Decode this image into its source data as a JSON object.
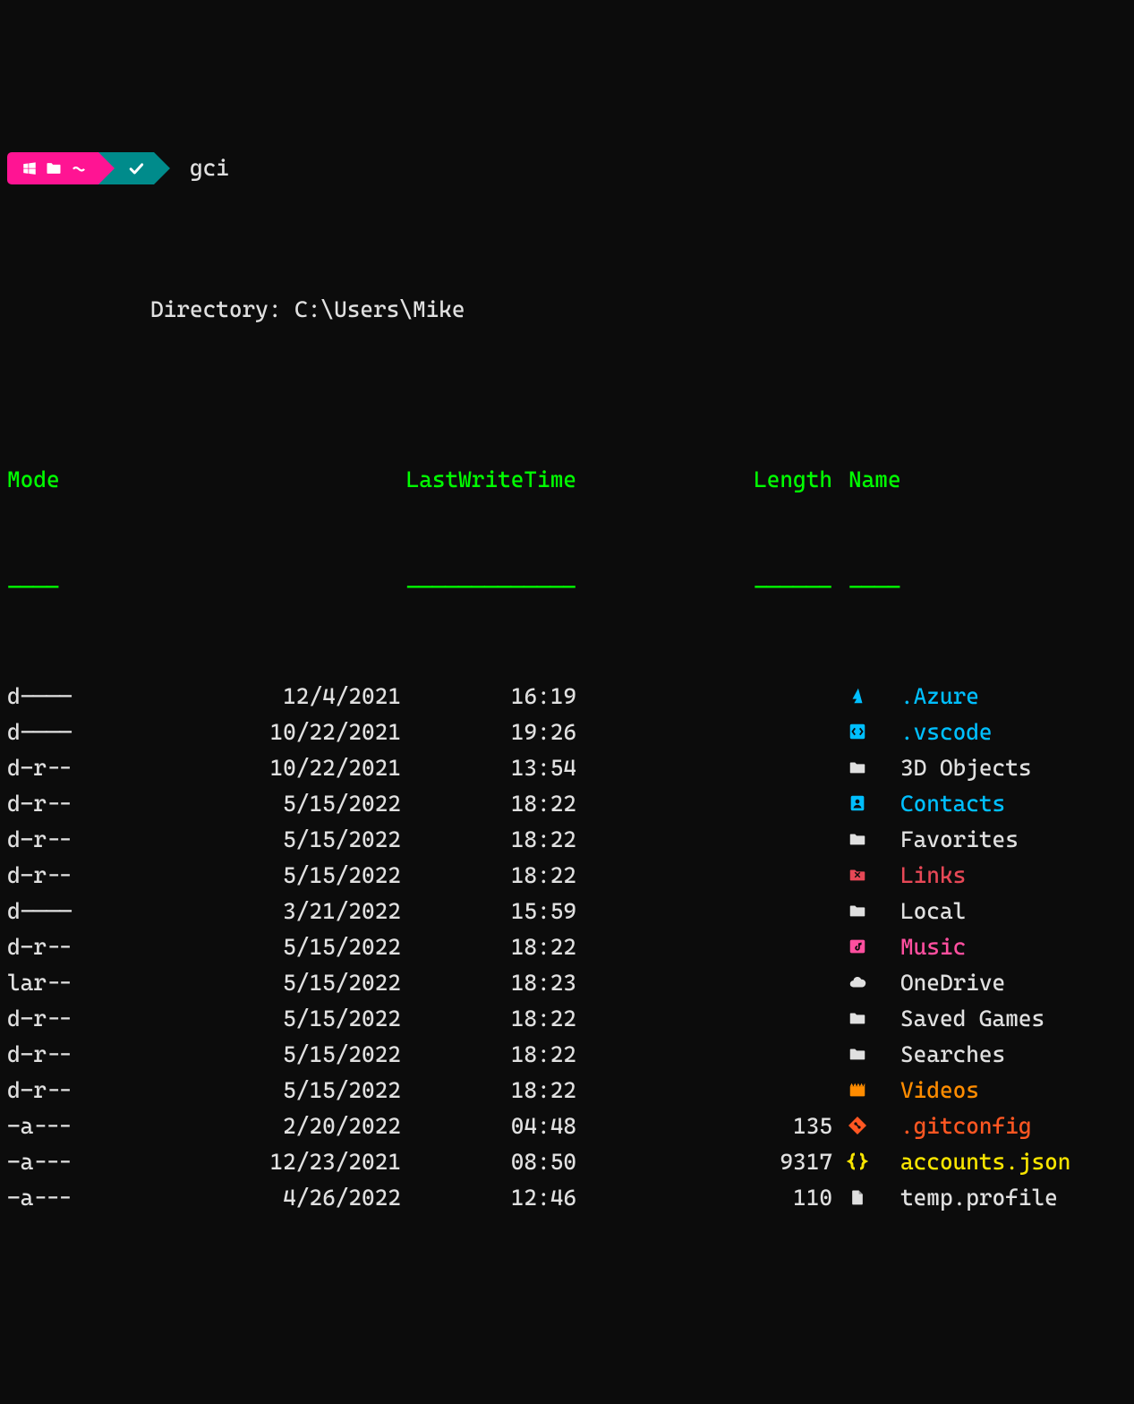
{
  "prompt": {
    "command": "gci"
  },
  "directory_label": "Directory: C:\\Users\\Mike",
  "headers": {
    "mode": "Mode",
    "lwt": "LastWriteTime",
    "length": "Length",
    "name": "Name"
  },
  "dashes": {
    "mode": "----",
    "lwt": "-------------",
    "length": "------",
    "name": "----"
  },
  "rows": [
    {
      "mode": "d----",
      "date": "12/4/2021",
      "time": "16:19",
      "length": "",
      "icon": "azure",
      "name": ".Azure",
      "color": "cyan",
      "iconColor": "#00bfff"
    },
    {
      "mode": "d----",
      "date": "10/22/2021",
      "time": "19:26",
      "length": "",
      "icon": "vscode",
      "name": ".vscode",
      "color": "cyan",
      "iconColor": "#00bfff"
    },
    {
      "mode": "d-r--",
      "date": "10/22/2021",
      "time": "13:54",
      "length": "",
      "icon": "folder",
      "name": "3D Objects",
      "color": "white",
      "iconColor": "#e0e0e0"
    },
    {
      "mode": "d-r--",
      "date": "5/15/2022",
      "time": "18:22",
      "length": "",
      "icon": "contacts",
      "name": "Contacts",
      "color": "cyan",
      "iconColor": "#00bfff"
    },
    {
      "mode": "d-r--",
      "date": "5/15/2022",
      "time": "18:22",
      "length": "",
      "icon": "folder",
      "name": "Favorites",
      "color": "white",
      "iconColor": "#e0e0e0"
    },
    {
      "mode": "d-r--",
      "date": "5/15/2022",
      "time": "18:22",
      "length": "",
      "icon": "links",
      "name": "Links",
      "color": "red",
      "iconColor": "#e74856"
    },
    {
      "mode": "d----",
      "date": "3/21/2022",
      "time": "15:59",
      "length": "",
      "icon": "folder",
      "name": "Local",
      "color": "white",
      "iconColor": "#e0e0e0"
    },
    {
      "mode": "d-r--",
      "date": "5/15/2022",
      "time": "18:22",
      "length": "",
      "icon": "music",
      "name": "Music",
      "color": "pink",
      "iconColor": "#ff4f9f"
    },
    {
      "mode": "lar--",
      "date": "5/15/2022",
      "time": "18:23",
      "length": "",
      "icon": "cloud",
      "name": "OneDrive",
      "color": "white",
      "iconColor": "#e0e0e0"
    },
    {
      "mode": "d-r--",
      "date": "5/15/2022",
      "time": "18:22",
      "length": "",
      "icon": "folder",
      "name": "Saved Games",
      "color": "white",
      "iconColor": "#e0e0e0"
    },
    {
      "mode": "d-r--",
      "date": "5/15/2022",
      "time": "18:22",
      "length": "",
      "icon": "folder",
      "name": "Searches",
      "color": "white",
      "iconColor": "#e0e0e0"
    },
    {
      "mode": "d-r--",
      "date": "5/15/2022",
      "time": "18:22",
      "length": "",
      "icon": "video",
      "name": "Videos",
      "color": "orange",
      "iconColor": "#ff8c00"
    },
    {
      "mode": "-a---",
      "date": "2/20/2022",
      "time": "04:48",
      "length": "135",
      "icon": "git",
      "name": ".gitconfig",
      "color": "orangered",
      "iconColor": "#ff5722"
    },
    {
      "mode": "-a---",
      "date": "12/23/2021",
      "time": "08:50",
      "length": "9317",
      "icon": "json",
      "name": "accounts.json",
      "color": "yellow",
      "iconColor": "#f9e500"
    },
    {
      "mode": "-a---",
      "date": "4/26/2022",
      "time": "12:46",
      "length": "110",
      "icon": "file",
      "name": "temp.profile",
      "color": "white",
      "iconColor": "#e0e0e0"
    }
  ]
}
